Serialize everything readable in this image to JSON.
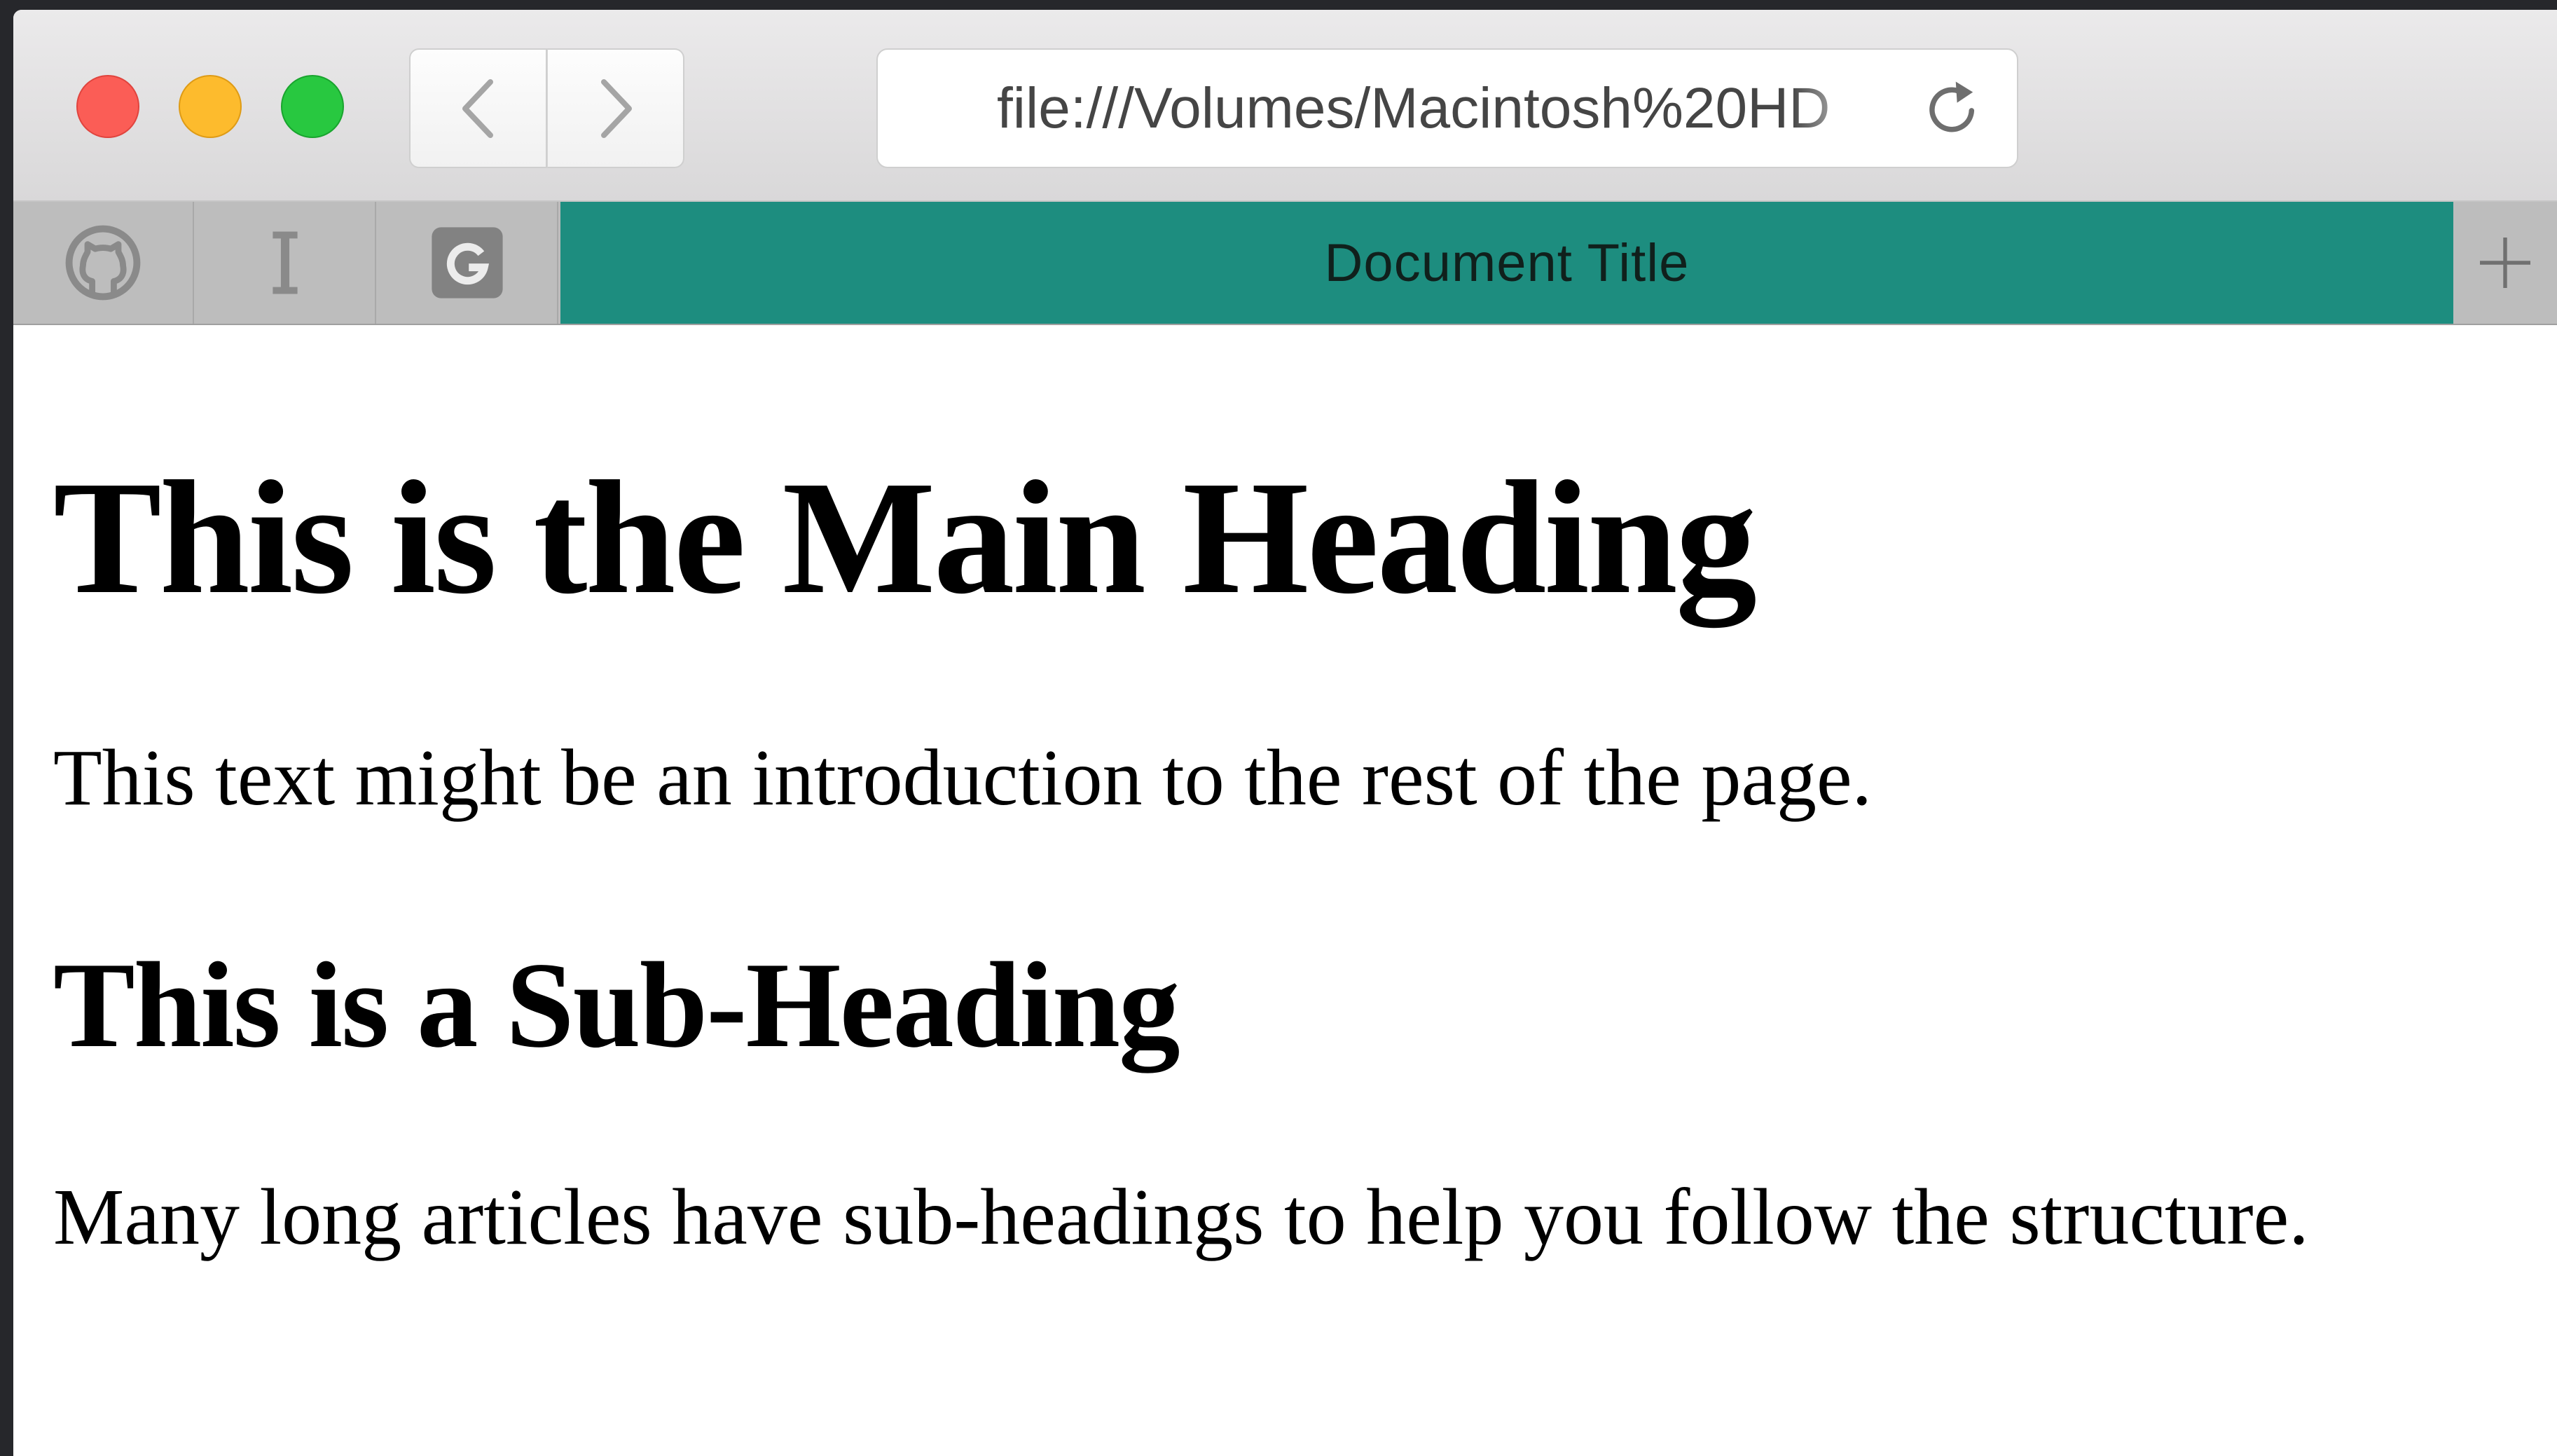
{
  "browser": {
    "url": "file:///Volumes/Macintosh%20HD",
    "colors": {
      "close": "#fb5d56",
      "minimize": "#fdbb2d",
      "zoom": "#28c840",
      "active_tab": "#1d8d7f"
    }
  },
  "tabs": {
    "pinned": [
      {
        "icon": "github-icon"
      },
      {
        "icon": "text-cursor-icon"
      },
      {
        "icon": "google-icon"
      }
    ],
    "active_title": "Document Title"
  },
  "page": {
    "main_heading": "This is the Main Heading",
    "intro": "This text might be an introduction to the rest of the page.",
    "sub_heading": "This is a Sub-Heading",
    "body": "Many long articles have sub-headings to help you follow the structure."
  }
}
